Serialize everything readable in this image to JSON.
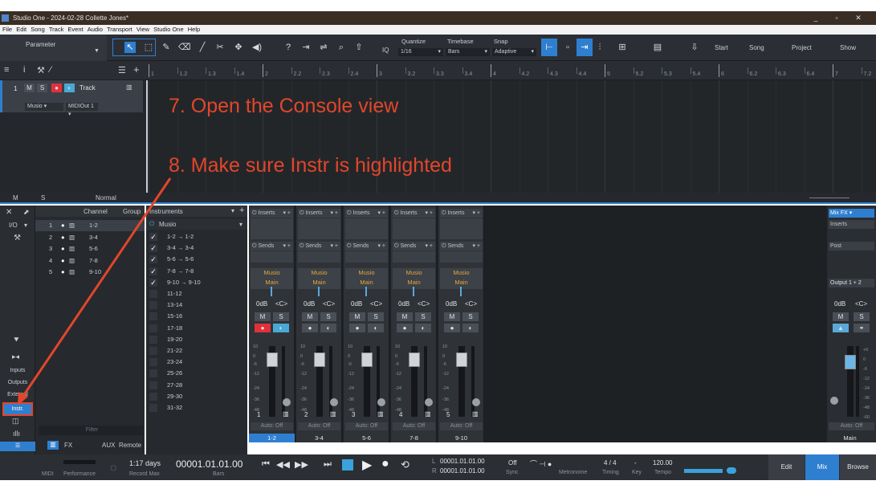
{
  "window": {
    "title": "Studio One - 2024-02-28 Collette Jones*",
    "controls": [
      "_",
      "▫",
      "✕"
    ]
  },
  "menu": [
    "File",
    "Edit",
    "Song",
    "Track",
    "Event",
    "Audio",
    "Transport",
    "View",
    "Studio One",
    "Help"
  ],
  "toolbar": {
    "parameter_label": "Parameter",
    "quantize_label": "Quantize",
    "quantize_value": "1/16",
    "timebase_label": "Timebase",
    "timebase_value": "Bars",
    "snap_label": "Snap",
    "snap_value": "Adaptive",
    "iq": "IQ",
    "start": "Start",
    "song": "Song",
    "project": "Project",
    "show": "Show"
  },
  "ruler": {
    "ticks": [
      "1",
      "1.2",
      "1.3",
      "1.4",
      "2",
      "2.2",
      "2.3",
      "2.4",
      "3",
      "3.2",
      "3.3",
      "3.4",
      "4",
      "4.2",
      "4.3",
      "4.4",
      "5",
      "5.2",
      "5.3",
      "5.4",
      "6",
      "6.2",
      "6.3",
      "6.4",
      "7",
      "7.2"
    ]
  },
  "track": {
    "number": "1",
    "m": "M",
    "s": "S",
    "name": "Track",
    "input": "Musio",
    "output": "MIDIOut 1"
  },
  "arrange_footer": {
    "m": "M",
    "s": "S",
    "mode": "Normal"
  },
  "annotations": {
    "step7": "7. Open the Console view",
    "step8": "8. Make sure Instr is highlighted"
  },
  "console_left": {
    "io": "I/O",
    "inputs": "Inputs",
    "outputs": "Outputs",
    "external": "External",
    "instr": "Instr.",
    "filter": "Filter"
  },
  "channel_list": {
    "header_channel": "Channel",
    "header_group": "Group",
    "rows": [
      {
        "n": "1",
        "label": "1-2"
      },
      {
        "n": "2",
        "label": "3-4"
      },
      {
        "n": "3",
        "label": "5-6"
      },
      {
        "n": "4",
        "label": "7-8"
      },
      {
        "n": "5",
        "label": "9-10"
      }
    ],
    "footer": {
      "fx": "FX",
      "aux": "AUX",
      "remote": "Remote"
    }
  },
  "instruments": {
    "header": "Instruments",
    "device": "Musio",
    "rows": [
      {
        "label": "1-2 → 1-2",
        "checked": "✓"
      },
      {
        "label": "3-4 → 3-4",
        "checked": "✓"
      },
      {
        "label": "5-6 → 5-6",
        "checked": "✓"
      },
      {
        "label": "7-8 → 7-8",
        "checked": "✓"
      },
      {
        "label": "9-10 → 9-10",
        "checked": "✓"
      },
      {
        "label": "11-12",
        "checked": ""
      },
      {
        "label": "13-14",
        "checked": ""
      },
      {
        "label": "15-16",
        "checked": ""
      },
      {
        "label": "17-18",
        "checked": ""
      },
      {
        "label": "19-20",
        "checked": ""
      },
      {
        "label": "21-22",
        "checked": ""
      },
      {
        "label": "23-24",
        "checked": ""
      },
      {
        "label": "25-26",
        "checked": ""
      },
      {
        "label": "27-28",
        "checked": ""
      },
      {
        "label": "29-30",
        "checked": ""
      },
      {
        "label": "31-32",
        "checked": ""
      }
    ]
  },
  "strips": [
    {
      "inserts": "Inserts",
      "sends": "Sends",
      "src": "Musio",
      "dst": "Main",
      "vol": "0dB",
      "pan": "<C>",
      "m": "M",
      "s": "S",
      "num": "1",
      "auto": "Auto: Off",
      "foot": "1-2"
    },
    {
      "inserts": "Inserts",
      "sends": "Sends",
      "src": "Musio",
      "dst": "Main",
      "vol": "0dB",
      "pan": "<C>",
      "m": "M",
      "s": "S",
      "num": "2",
      "auto": "Auto: Off",
      "foot": "3-4"
    },
    {
      "inserts": "Inserts",
      "sends": "Sends",
      "src": "Musio",
      "dst": "Main",
      "vol": "0dB",
      "pan": "<C>",
      "m": "M",
      "s": "S",
      "num": "3",
      "auto": "Auto: Off",
      "foot": "5-6"
    },
    {
      "inserts": "Inserts",
      "sends": "Sends",
      "src": "Musio",
      "dst": "Main",
      "vol": "0dB",
      "pan": "<C>",
      "m": "M",
      "s": "S",
      "num": "4",
      "auto": "Auto: Off",
      "foot": "7-8"
    },
    {
      "inserts": "Inserts",
      "sends": "Sends",
      "src": "Musio",
      "dst": "Main",
      "vol": "0dB",
      "pan": "<C>",
      "m": "M",
      "s": "S",
      "num": "5",
      "auto": "Auto: Off",
      "foot": "9-10"
    }
  ],
  "scale": [
    "10",
    "0",
    "-6",
    "-12",
    "-24",
    "-36",
    "-48"
  ],
  "main": {
    "mixfx": "Mix FX",
    "inserts": "Inserts",
    "post": "Post",
    "output": "Output 1 + 2",
    "vol": "0dB",
    "pan": "<C>",
    "m": "M",
    "s": "S",
    "auto": "Auto: Off",
    "foot": "Main",
    "scale": [
      "+6",
      "0",
      "-6",
      "-12",
      "-24",
      "-36",
      "-48",
      "-60"
    ]
  },
  "transport": {
    "midi": "MIDI",
    "performance": "Performance",
    "recmax_value": "1:17 days",
    "recmax_label": "Record Max",
    "position": "00001.01.01.00",
    "position_unit": "Bars",
    "l": "L",
    "r": "R",
    "l_value": "00001.01.01.00",
    "r_value": "00001.01.01.00",
    "sync_value": "Off",
    "sync_label": "Sync",
    "metronome": "Metronome",
    "timing_value": "4 / 4",
    "timing_label": "Timing",
    "key_value": "-",
    "key_label": "Key",
    "tempo_value": "120.00",
    "tempo_label": "Tempo",
    "edit": "Edit",
    "mix": "Mix",
    "browse": "Browse"
  },
  "colors": {
    "accent": "#2f7fd0",
    "annotation": "#e2462b",
    "routing": "#e6a63a"
  }
}
